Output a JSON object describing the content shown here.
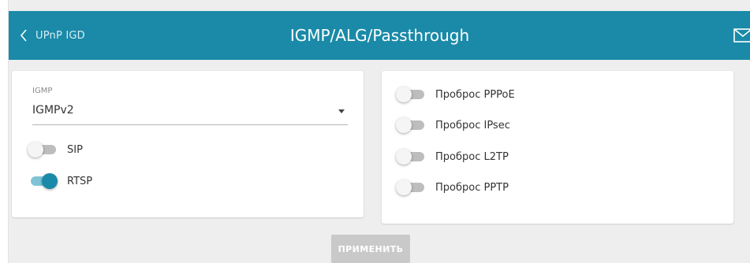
{
  "header": {
    "back_label": "UPnP IGD",
    "title": "IGMP/ALG/Passthrough"
  },
  "igmp": {
    "label": "IGMP",
    "value": "IGMPv2"
  },
  "alg": [
    {
      "label": "SIP",
      "enabled": false
    },
    {
      "label": "RTSP",
      "enabled": true
    }
  ],
  "passthrough": [
    {
      "label": "Проброс PPPoE",
      "enabled": false
    },
    {
      "label": "Проброс IPsec",
      "enabled": false
    },
    {
      "label": "Проброс L2TP",
      "enabled": false
    },
    {
      "label": "Проброс PPTP",
      "enabled": false
    }
  ],
  "apply_label": "ПРИМЕНИТЬ",
  "colors": {
    "accent": "#1a8aa8",
    "background": "#eeeeee",
    "apply_disabled": "#c9c9c9"
  }
}
